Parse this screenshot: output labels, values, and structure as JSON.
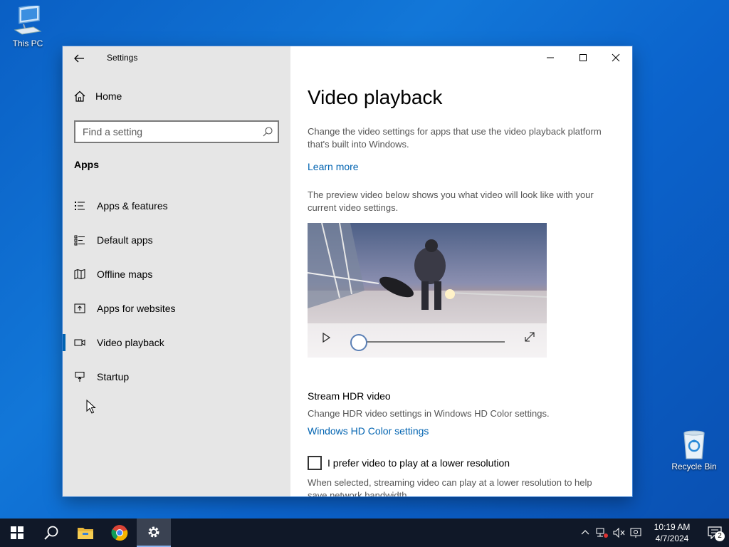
{
  "desktop": {
    "this_pc": "This PC",
    "recycle_bin": "Recycle Bin"
  },
  "window": {
    "title": "Settings"
  },
  "sidebar": {
    "home": "Home",
    "search_placeholder": "Find a setting",
    "section": "Apps",
    "items": [
      {
        "label": "Apps & features",
        "icon": "list-icon"
      },
      {
        "label": "Default apps",
        "icon": "default-apps-icon"
      },
      {
        "label": "Offline maps",
        "icon": "map-icon"
      },
      {
        "label": "Apps for websites",
        "icon": "web-app-icon"
      },
      {
        "label": "Video playback",
        "icon": "video-icon",
        "active": true
      },
      {
        "label": "Startup",
        "icon": "startup-icon"
      }
    ]
  },
  "content": {
    "title": "Video playback",
    "description": "Change the video settings for apps that use the video playback platform that's built into Windows.",
    "learn_more": "Learn more",
    "preview_text": "The preview video below shows you what video will look like with your current video settings.",
    "hdr_heading": "Stream HDR video",
    "hdr_description": "Change HDR video settings in Windows HD Color settings.",
    "hdr_link": "Windows HD Color settings",
    "lowres_checkbox": "I prefer video to play at a lower resolution",
    "lowres_description": "When selected, streaming video can play at a lower resolution to help save network bandwidth"
  },
  "taskbar": {
    "time": "10:19 AM",
    "date": "4/7/2024",
    "notification_count": "2"
  },
  "colors": {
    "accent": "#0063b1",
    "sidebar_bg": "#e6e6e6",
    "taskbar_bg": "#101828"
  }
}
